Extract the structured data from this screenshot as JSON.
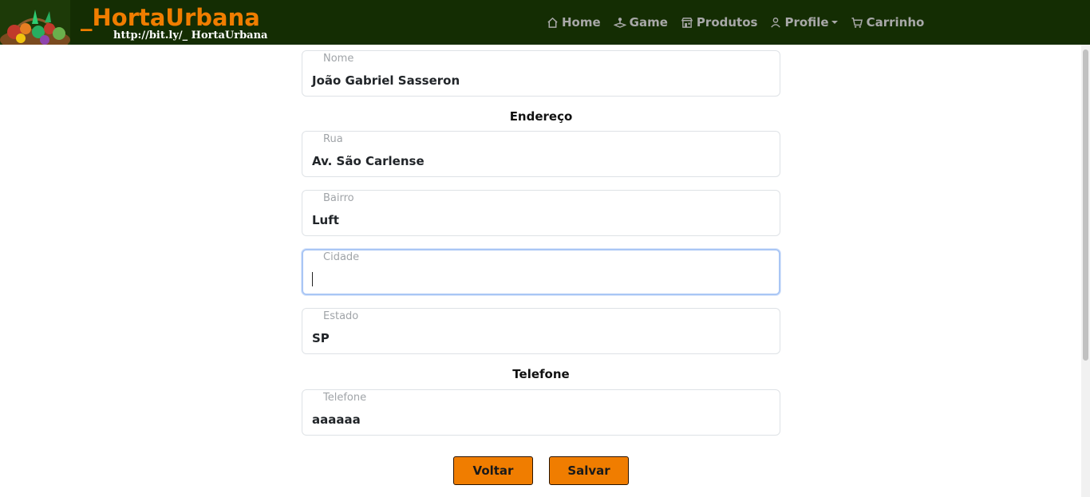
{
  "brand": {
    "title": "_HortaUrbana",
    "url": "http://bit.ly/_ HortaUrbana"
  },
  "nav": {
    "items": [
      {
        "label": "Home",
        "icon": "home-icon"
      },
      {
        "label": "Game",
        "icon": "joystick-icon"
      },
      {
        "label": "Produtos",
        "icon": "shop-icon"
      },
      {
        "label": "Profile",
        "icon": "person-icon"
      },
      {
        "label": "Carrinho",
        "icon": "cart-icon"
      }
    ]
  },
  "form": {
    "nome": {
      "label": "Nome",
      "value": "João Gabriel Sasseron"
    },
    "endereco_title": "Endereço",
    "rua": {
      "label": "Rua",
      "value": "Av. São Carlense"
    },
    "bairro": {
      "label": "Bairro",
      "value": "Luft"
    },
    "cidade": {
      "label": "Cidade",
      "value": ""
    },
    "estado": {
      "label": "Estado",
      "value": "SP"
    },
    "telefone_title": "Telefone",
    "telefone": {
      "label": "Telefone",
      "value": "aaaaaa"
    },
    "voltar_label": "Voltar",
    "salvar_label": "Salvar"
  },
  "colors": {
    "navbar_bg": "#142d03",
    "accent": "#f07d00"
  }
}
